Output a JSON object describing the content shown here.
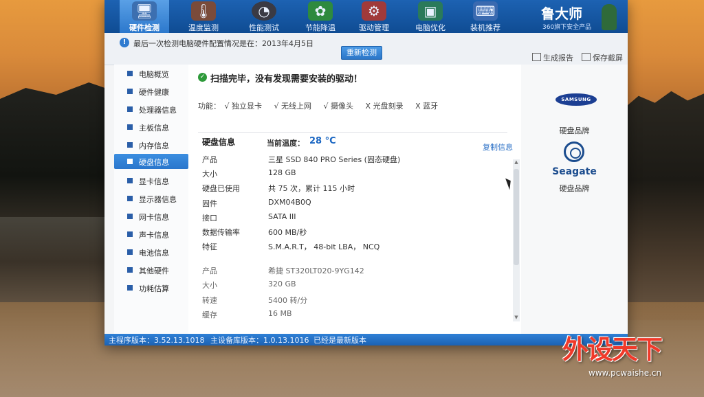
{
  "tabs": [
    {
      "label": "硬件检测",
      "icon": "hardware-check-icon",
      "active": true
    },
    {
      "label": "温度监测",
      "icon": "temperature-monitor-icon"
    },
    {
      "label": "性能测试",
      "icon": "performance-test-icon"
    },
    {
      "label": "节能降温",
      "icon": "energy-saving-icon"
    },
    {
      "label": "驱动管理",
      "icon": "driver-management-icon"
    },
    {
      "label": "电脑优化",
      "icon": "pc-optimize-icon"
    },
    {
      "label": "装机推荐",
      "icon": "build-recommend-icon"
    }
  ],
  "brand": {
    "name": "鲁大师",
    "subtitle": "360旗下安全产品"
  },
  "info": {
    "text": "最后一次检测电脑硬件配置情况是在：2013年4月5日",
    "recheck_label": "重新检测",
    "generate_report": "生成报告",
    "save_screenshot": "保存截屏"
  },
  "sidebar": {
    "items": [
      {
        "label": "电脑概览"
      },
      {
        "label": "硬件健康"
      },
      {
        "label": "处理器信息"
      },
      {
        "label": "主板信息"
      },
      {
        "label": "内存信息"
      },
      {
        "label": "硬盘信息",
        "active": true
      },
      {
        "label": "显卡信息"
      },
      {
        "label": "显示器信息"
      },
      {
        "label": "网卡信息"
      },
      {
        "label": "声卡信息"
      },
      {
        "label": "电池信息"
      },
      {
        "label": "其他硬件"
      },
      {
        "label": "功耗估算"
      }
    ]
  },
  "content": {
    "status": "扫描完毕，没有发现需要安装的驱动！",
    "features_label": "功能：",
    "features": [
      "√ 独立显卡",
      "√ 无线上网",
      "√ 摄像头",
      "X 光盘刻录",
      "X 蓝牙"
    ],
    "section_title": "硬盘信息",
    "temp_label": "当前温度：",
    "temp_value": "28 °C",
    "copy_label": "复制信息",
    "disk1": [
      {
        "k": "产品",
        "v": "三星 SSD 840 PRO Series (固态硬盘)"
      },
      {
        "k": "大小",
        "v": "128 GB"
      },
      {
        "k": "硬盘已使用",
        "v": "共 75 次，累计 115 小时"
      },
      {
        "k": "固件",
        "v": "DXM04B0Q"
      },
      {
        "k": "接口",
        "v": "SATA III"
      },
      {
        "k": "数据传输率",
        "v": "600 MB/秒"
      },
      {
        "k": "特征",
        "v": "S.M.A.R.T， 48-bit LBA， NCQ"
      }
    ],
    "disk2": [
      {
        "k": "产品",
        "v": "希捷 ST320LT020-9YG142"
      },
      {
        "k": "大小",
        "v": "320 GB"
      },
      {
        "k": "转速",
        "v": "5400 转/分"
      },
      {
        "k": "缓存",
        "v": "16 MB"
      }
    ]
  },
  "brands_panel": {
    "samsung_logo_text": "SAMSUNG",
    "caption1": "硬盘品牌",
    "seagate_logo_text": "Seagate",
    "caption2": "硬盘品牌"
  },
  "statusbar": {
    "main_version": "主程序版本：3.52.13.1018",
    "db_version": "主设备库版本：1.0.13.1016",
    "update_status": "已经是最新版本"
  },
  "watermark": {
    "text": "外设天下",
    "url": "www.pcwaishe.cn"
  }
}
